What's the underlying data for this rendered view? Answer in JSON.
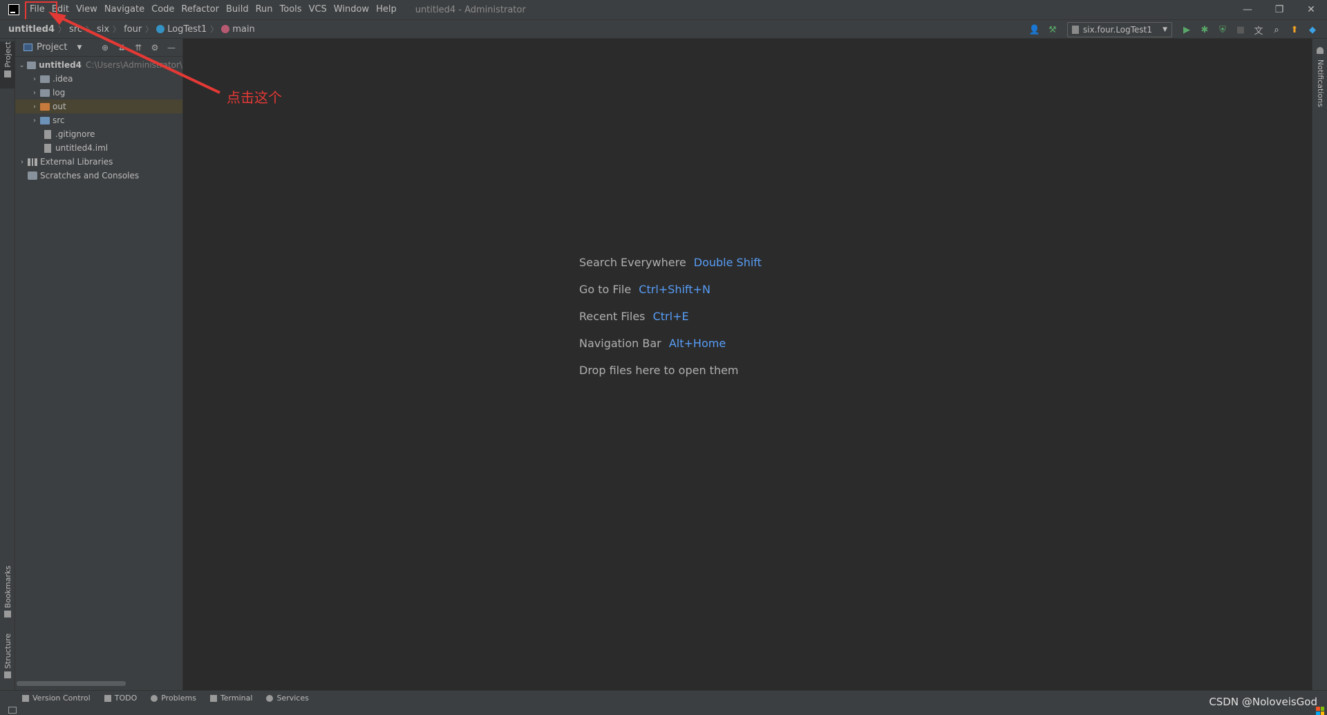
{
  "menu": {
    "items": [
      "File",
      "Edit",
      "View",
      "Navigate",
      "Code",
      "Refactor",
      "Build",
      "Run",
      "Tools",
      "VCS",
      "Window",
      "Help"
    ],
    "window_title": "untitled4 - Administrator"
  },
  "window_controls": {
    "minimize": "—",
    "restore": "❐",
    "close": "✕"
  },
  "breadcrumb": {
    "items": [
      "untitled4",
      "src",
      "six",
      "four",
      "LogTest1",
      "main"
    ]
  },
  "toolbar": {
    "run_config": "six.four.LogTest1"
  },
  "left_strip": {
    "project": "Project",
    "bookmarks": "Bookmarks",
    "structure": "Structure"
  },
  "right_strip": {
    "notifications": "Notifications"
  },
  "project_panel": {
    "title": "Project",
    "tree": [
      {
        "label": "untitled4",
        "path": "C:\\Users\\Administrator\\",
        "expanded": true
      },
      {
        "label": ".idea"
      },
      {
        "label": "log"
      },
      {
        "label": "out"
      },
      {
        "label": "src"
      },
      {
        "label": ".gitignore"
      },
      {
        "label": "untitled4.iml"
      },
      {
        "label": "External Libraries"
      },
      {
        "label": "Scratches and Consoles"
      }
    ]
  },
  "editor_hints": [
    {
      "label": "Search Everywhere",
      "key": "Double Shift"
    },
    {
      "label": "Go to File",
      "key": "Ctrl+Shift+N"
    },
    {
      "label": "Recent Files",
      "key": "Ctrl+E"
    },
    {
      "label": "Navigation Bar",
      "key": "Alt+Home"
    },
    {
      "label": "Drop files here to open them",
      "key": ""
    }
  ],
  "annotation": {
    "text": "点击这个",
    "color": "#e53935"
  },
  "bottom_tools": [
    "Version Control",
    "TODO",
    "Problems",
    "Terminal",
    "Services"
  ],
  "watermark": "CSDN @NoloveisGod",
  "colors": {
    "accent": "#589df6",
    "annotation": "#e53935",
    "panel_bg": "#3c3f41",
    "editor_bg": "#2b2b2b"
  }
}
